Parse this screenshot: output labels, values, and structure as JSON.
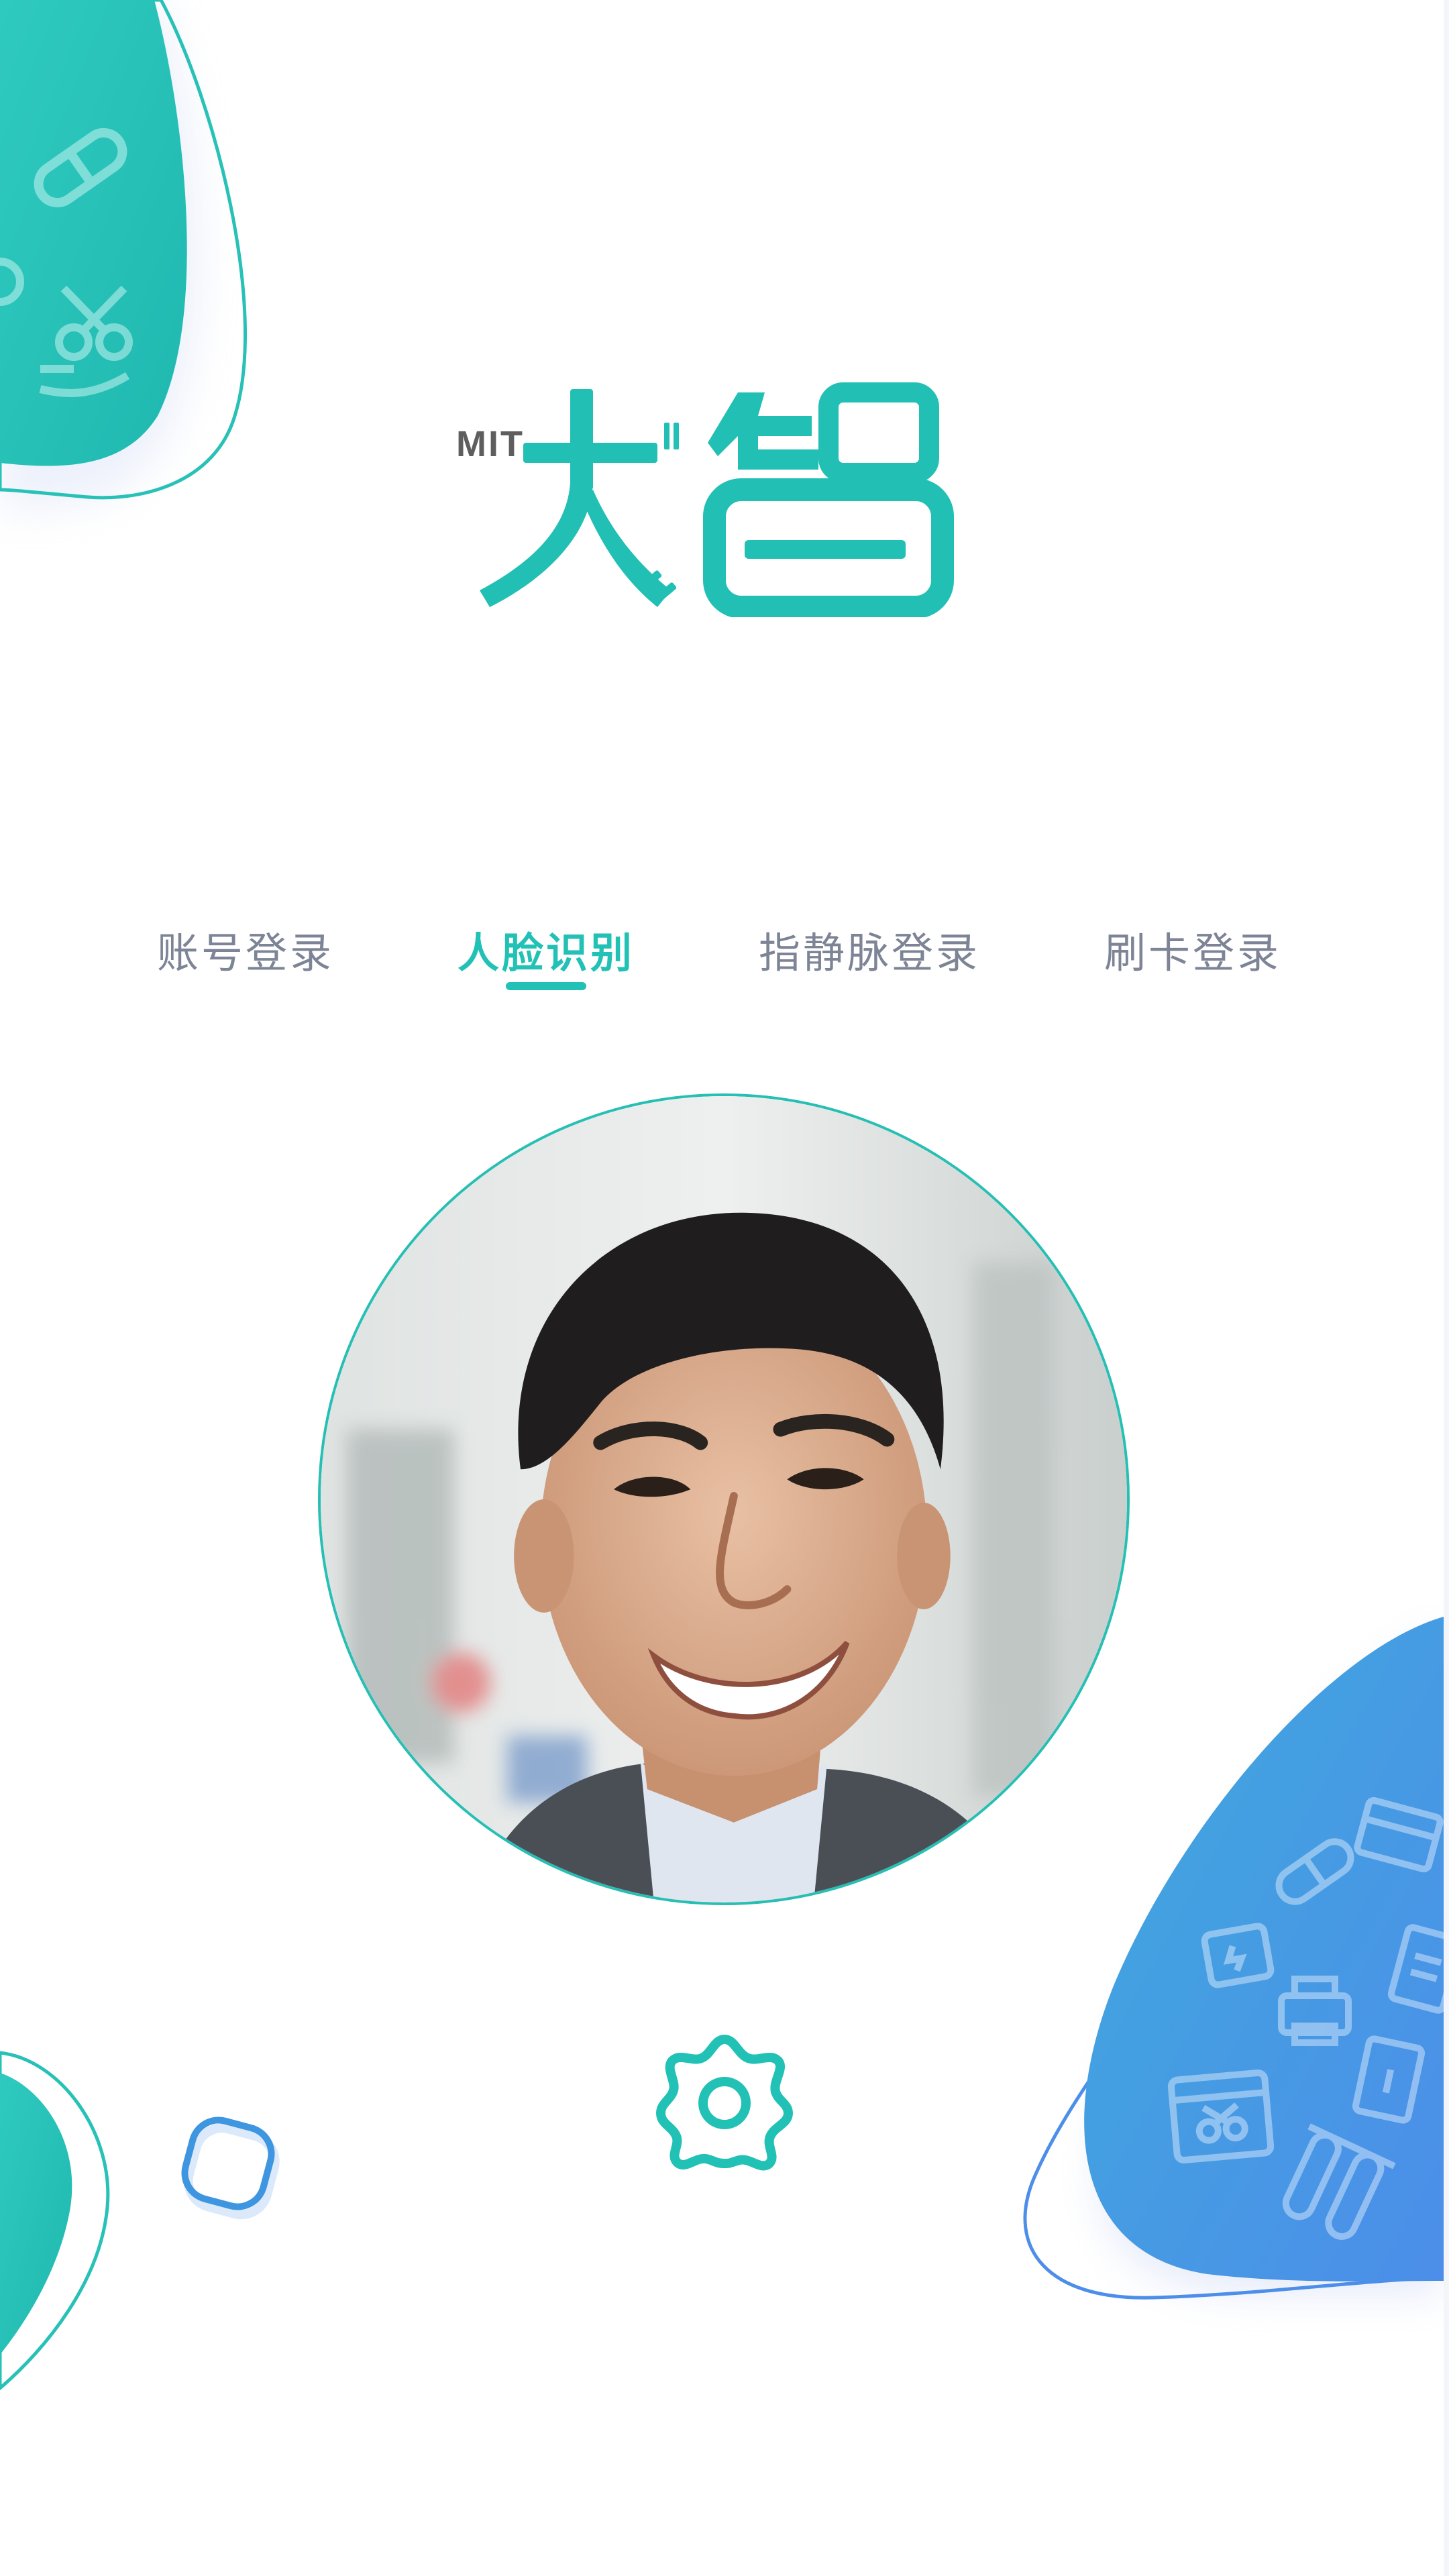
{
  "logo": {
    "prefix": "MIT"
  },
  "tabs": [
    {
      "label": "账号登录",
      "active": false
    },
    {
      "label": "人脸识别",
      "active": true
    },
    {
      "label": "指静脉登录",
      "active": false
    },
    {
      "label": "刷卡登录",
      "active": false
    }
  ],
  "colors": {
    "accent": "#22c1b6",
    "inactive_tab": "#7c8496",
    "teal_blob": "#26c4bb",
    "blue_blob": "#4a9fe6"
  },
  "icons": {
    "settings": "gear-icon",
    "top_left_blob": [
      "capsule-icon",
      "scissors-icon",
      "hand-icon"
    ],
    "bottom_right_blob": [
      "capsule-icon",
      "battery-icon",
      "printer-icon",
      "calendar-icon",
      "document-icon",
      "test-tube-icon",
      "box-icon"
    ]
  }
}
